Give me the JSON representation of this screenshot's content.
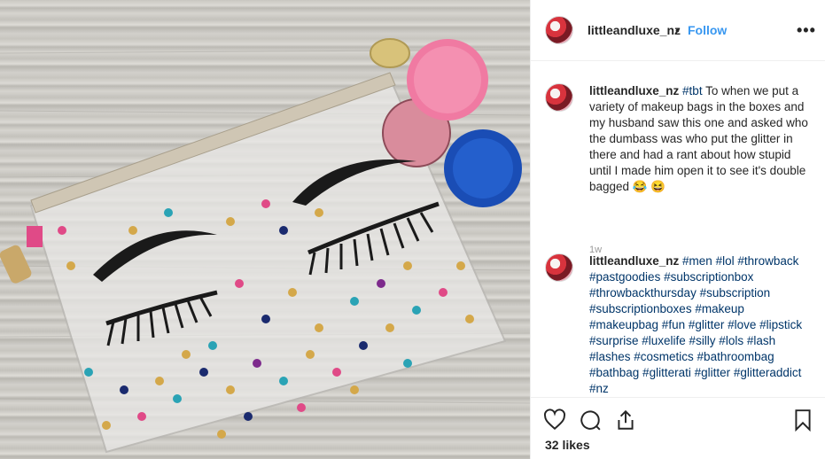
{
  "post": {
    "username": "littleandluxe_nz",
    "separator": "•",
    "follow_label": "Follow",
    "more_icon": "more-options-icon"
  },
  "caption": {
    "username": "littleandluxe_nz",
    "hashtag": "#tbt",
    "text": " To when we put a variety of makeup bags in the boxes and my husband saw this one and asked who the dumbass was who put the glitter in there and had a rant about how stupid until I made him open it to see it's double bagged 😂 😆",
    "time": "1w"
  },
  "comment": {
    "username": "littleandluxe_nz",
    "hashtags": "#men #lol #throwback #pastgoodies #subscriptionbox #throwbackthursday #subscription #subscriptionboxes #makeup #makeupbag #fun #glitter #love #lipstick #surprise #luxelife #silly #lols #lash #lashes #cosmetics #bathroombag #bathbag #glitterati #glitter #glitteraddict #nz"
  },
  "actions": {
    "icons": [
      "heart-icon",
      "comment-icon",
      "share-icon",
      "bookmark-icon"
    ],
    "likes": "32 likes"
  },
  "colors": {
    "link_blue": "#3897f0",
    "hashtag": "#003569",
    "text": "#262626",
    "muted": "#999999"
  }
}
